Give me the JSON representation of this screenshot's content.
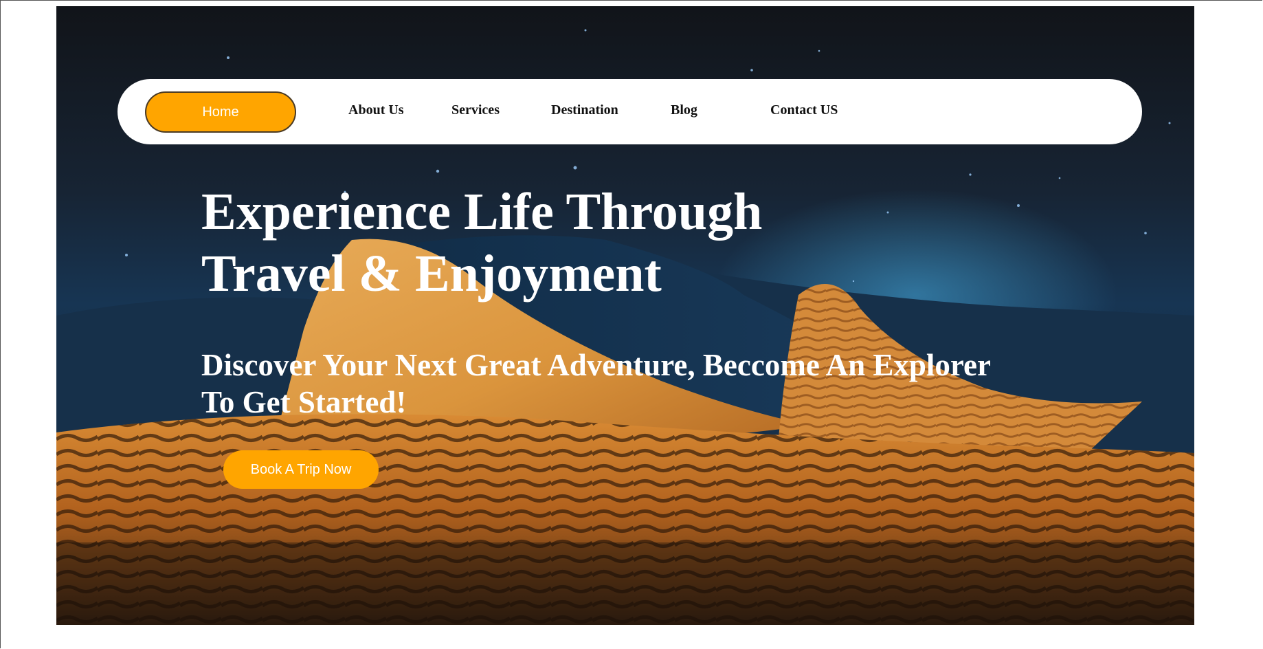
{
  "nav": {
    "home": "Home",
    "items": [
      {
        "label": "About Us"
      },
      {
        "label": "Services"
      },
      {
        "label": "Destination"
      },
      {
        "label": "Blog"
      },
      {
        "label": "Contact US"
      }
    ]
  },
  "hero": {
    "headline_line1": "Experience Life Through",
    "headline_line2": "Travel & Enjoyment",
    "subheadline_line1": "Discover Your Next Great Adventure, Beccome An Explorer",
    "subheadline_line2": "To Get Started!",
    "cta": "Book A Trip Now",
    "background_image": "night desert dunes under starry sky"
  },
  "colors": {
    "accent": "#ffa500",
    "nav_background": "#ffffff",
    "hero_text": "#ffffff"
  }
}
